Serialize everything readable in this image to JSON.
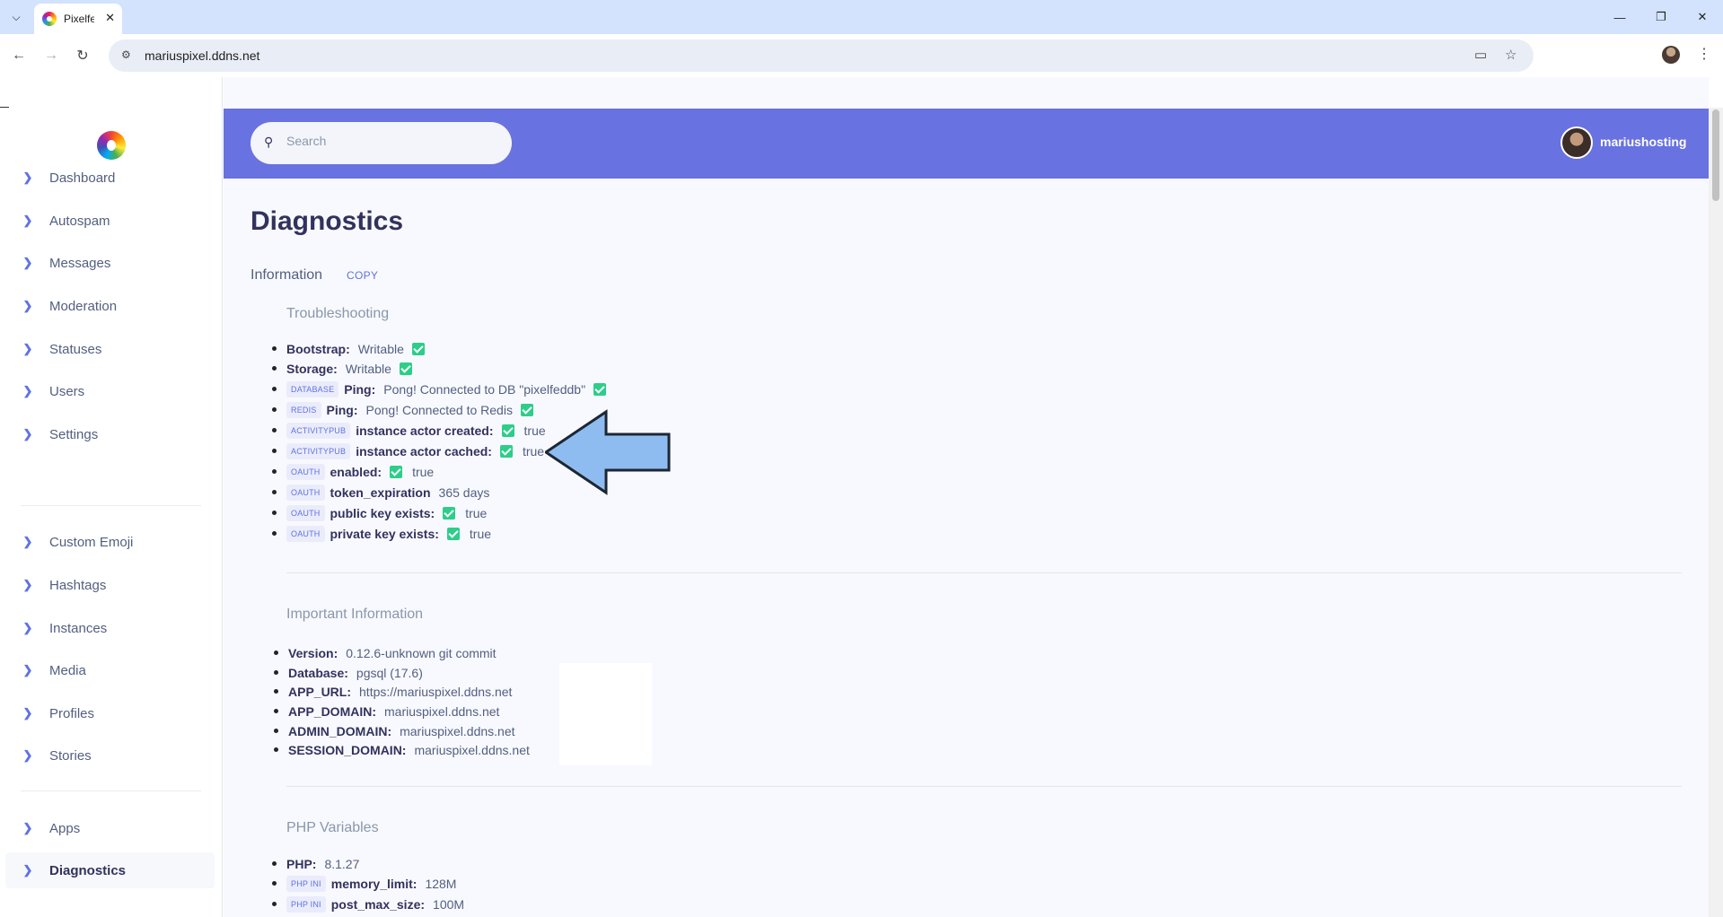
{
  "browser": {
    "tab_title": "Pixelfe",
    "url": "mariuspixel.ddns.net",
    "icons": [
      "tab-list-icon",
      "tab-close-icon",
      "minimize-icon",
      "restore-icon",
      "close-window-icon",
      "back-icon",
      "forward-icon",
      "reload-icon",
      "site-info-icon",
      "install-icon",
      "bookmark-star-icon",
      "profile-icon",
      "menu-icon"
    ]
  },
  "sidebar": {
    "items": [
      {
        "label": "Dashboard"
      },
      {
        "label": "Autospam"
      },
      {
        "label": "Messages"
      },
      {
        "label": "Moderation"
      },
      {
        "label": "Statuses"
      },
      {
        "label": "Users"
      },
      {
        "label": "Settings"
      },
      {
        "label": "Custom Emoji"
      },
      {
        "label": "Hashtags"
      },
      {
        "label": "Instances"
      },
      {
        "label": "Media"
      },
      {
        "label": "Profiles"
      },
      {
        "label": "Stories"
      },
      {
        "label": "Apps"
      },
      {
        "label": "Diagnostics"
      }
    ],
    "active_item": "Diagnostics",
    "accent_color": "#5e72e4"
  },
  "header": {
    "search_placeholder": "Search",
    "username": "mariushosting",
    "bar_color": "#6872e0"
  },
  "page": {
    "title": "Diagnostics",
    "info_heading": "Information",
    "copy_label": "COPY"
  },
  "troubleshooting": {
    "heading": "Troubleshooting",
    "rows": [
      {
        "key": "Bootstrap:",
        "value": "Writable",
        "check": true
      },
      {
        "key": "Storage:",
        "value": "Writable",
        "check": true
      },
      {
        "tag": "DATABASE",
        "key": "Ping:",
        "value": "Pong! Connected to DB \"pixelfeddb\"",
        "check": true
      },
      {
        "tag": "REDIS",
        "key": "Ping:",
        "value": "Pong! Connected to Redis",
        "check": true
      },
      {
        "tag": "ACTIVITYPUB",
        "key": "instance actor created:",
        "value": "true",
        "check": true
      },
      {
        "tag": "ACTIVITYPUB",
        "key": "instance actor cached:",
        "value": "true",
        "check": true
      },
      {
        "tag": "OAUTH",
        "key": "enabled:",
        "value": "true",
        "check": true
      },
      {
        "tag": "OAUTH",
        "key": "token_expiration",
        "value": "365 days",
        "check": false
      },
      {
        "tag": "OAUTH",
        "key": "public key exists:",
        "value": "true",
        "check": true
      },
      {
        "tag": "OAUTH",
        "key": "private key exists:",
        "value": "true",
        "check": true
      }
    ]
  },
  "important": {
    "heading": "Important Information",
    "rows": [
      {
        "key": "Version:",
        "value": "0.12.6-unknown git commit"
      },
      {
        "key": "Database:",
        "value": "pgsql (17.6)"
      },
      {
        "key": "APP_URL:",
        "value": "https://mariuspixel.ddns.net"
      },
      {
        "key": "APP_DOMAIN:",
        "value": "mariuspixel.ddns.net"
      },
      {
        "key": "ADMIN_DOMAIN:",
        "value": "mariuspixel.ddns.net"
      },
      {
        "key": "SESSION_DOMAIN:",
        "value": "mariuspixel.ddns.net"
      }
    ]
  },
  "php": {
    "heading": "PHP Variables",
    "rows": [
      {
        "key": "PHP:",
        "value": "8.1.27"
      },
      {
        "tag": "PHP INI",
        "key": "memory_limit:",
        "value": "128M"
      },
      {
        "tag": "PHP INI",
        "key": "post_max_size:",
        "value": "100M"
      }
    ]
  },
  "colors": {
    "check_green": "#2dce89",
    "annotation_arrow": "#8fbcf0"
  }
}
